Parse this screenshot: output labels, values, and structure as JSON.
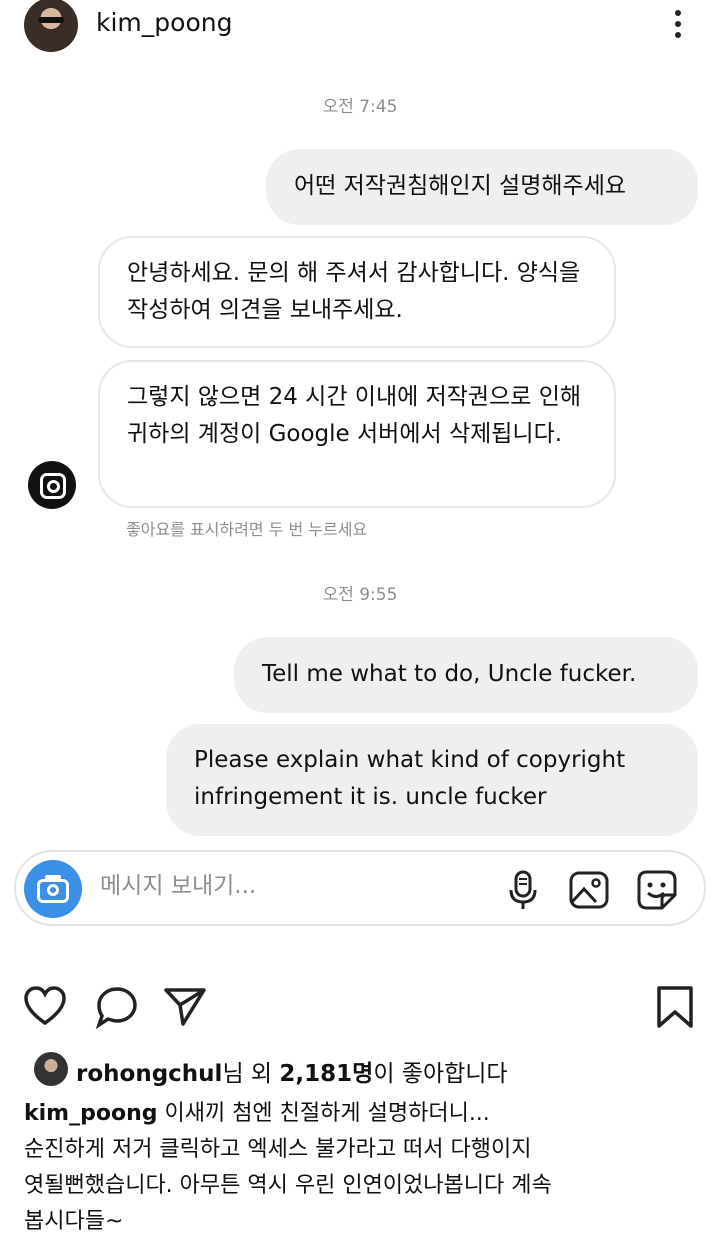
{
  "header": {
    "username": "kim_poong"
  },
  "messages": {
    "timestamp_1": "오전 7:45",
    "m1": "어떤 저작권침해인지 설명해주세요",
    "m2": "안녕하세요. 문의 해 주셔서 감사합니다. 양식을 작성하여 의견을 보내주세요.",
    "m3": "그렇지 않으면 24 시간 이내에 저작권으로 인해 귀하의 계정이 Google 서버에서 삭제됩니다.",
    "like_hint": "좋아요를 표시하려면 두 번 누르세요",
    "timestamp_2": "오전 9:55",
    "m4": "Tell me what to do, Uncle fucker.",
    "m5": "Please explain what kind of copyright infringement it is. uncle fucker"
  },
  "composer": {
    "placeholder": "메시지 보내기..."
  },
  "post": {
    "liked_by_user": "rohongchul",
    "likes_mid": "님 외 ",
    "likes_count": "2,181명",
    "likes_suffix": "이 좋아합니다",
    "caption_user": "kim_poong",
    "caption_text": " 이새끼 첨엔 친절하게 설명하더니...\n순진하게 저거 클릭하고 엑세스 불가라고 떠서 다행이지\n엿될뻔했습니다. 아무튼 역시 우린 인연이었나봅니다 계속\n봅시다들~"
  },
  "colors": {
    "accent_blue": "#3b8fe7",
    "bubble_gray": "#efefef",
    "meta_gray": "#8e8e8e"
  }
}
